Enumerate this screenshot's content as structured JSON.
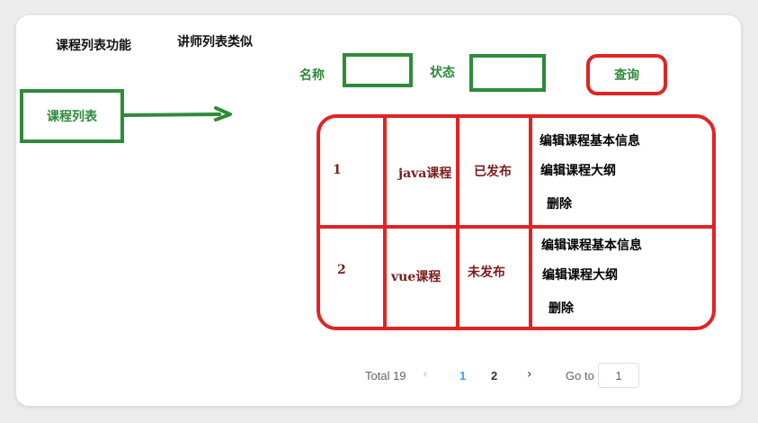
{
  "sketch": {
    "title": "课程列表功能",
    "subtitle": "讲师列表类似",
    "sidebar_label": "课程列表",
    "search": {
      "name_label": "名称",
      "status_label": "状态",
      "name_value": "",
      "status_value": "",
      "query_label": "查询"
    },
    "rows": [
      {
        "id": "1",
        "name": "java课程",
        "status": "已发布",
        "actions": [
          "编辑课程基本信息",
          "编辑课程大纲",
          "删除"
        ]
      },
      {
        "id": "2",
        "name": "vue课程",
        "status": "未发布",
        "actions": [
          "编辑课程基本信息",
          "编辑课程大纲",
          "删除"
        ]
      }
    ],
    "colors": {
      "green": "#2e8b3a",
      "red": "#e02424",
      "dark_red": "#7a1b1b"
    }
  },
  "pagination": {
    "total": "Total 19",
    "prev_icon": "chevron-left-icon",
    "next_icon": "chevron-right-icon",
    "pages": [
      "1",
      "2"
    ],
    "active_page": "1",
    "goto_label": "Go to",
    "goto_value": "1",
    "active_color": "#409eff"
  }
}
